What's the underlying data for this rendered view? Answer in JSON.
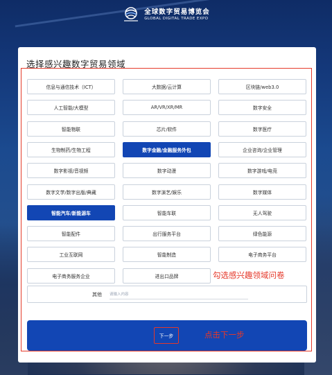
{
  "header": {
    "logo_cn": "全球数字贸易博览会",
    "logo_en": "GLOBAL DIGITAL TRADE EXPO"
  },
  "panel": {
    "title": "选择感兴趣数字贸易领域",
    "options": [
      {
        "label": "信息与通信技术（ICT）",
        "selected": false
      },
      {
        "label": "大数据/云计算",
        "selected": false
      },
      {
        "label": "区块链/web3.0",
        "selected": false
      },
      {
        "label": "人工智能/大模型",
        "selected": false
      },
      {
        "label": "AR/VR/XR/MR",
        "selected": false
      },
      {
        "label": "数字安全",
        "selected": false
      },
      {
        "label": "智能物联",
        "selected": false
      },
      {
        "label": "芯片/软件",
        "selected": false
      },
      {
        "label": "数字医疗",
        "selected": false
      },
      {
        "label": "生物制药/生物工程",
        "selected": false
      },
      {
        "label": "数字金融/金融服务外包",
        "selected": true
      },
      {
        "label": "企业咨询/企业管理",
        "selected": false
      },
      {
        "label": "数字影视/音视频",
        "selected": false
      },
      {
        "label": "数字动漫",
        "selected": false
      },
      {
        "label": "数字游戏/电竞",
        "selected": false
      },
      {
        "label": "数字文学/数字出版/典藏",
        "selected": false
      },
      {
        "label": "数字演艺/娱乐",
        "selected": false
      },
      {
        "label": "数字媒体",
        "selected": false
      },
      {
        "label": "智能汽车/新能源车",
        "selected": true
      },
      {
        "label": "智能车联",
        "selected": false
      },
      {
        "label": "无人驾驶",
        "selected": false
      },
      {
        "label": "智能配件",
        "selected": false
      },
      {
        "label": "出行服务平台",
        "selected": false
      },
      {
        "label": "绿色能源",
        "selected": false
      },
      {
        "label": "工业互联网",
        "selected": false
      },
      {
        "label": "智能制造",
        "selected": false
      },
      {
        "label": "电子商务平台",
        "selected": false
      },
      {
        "label": "电子商务服务企业",
        "selected": false
      },
      {
        "label": "进出口品牌",
        "selected": false
      }
    ],
    "other_label": "其他",
    "other_placeholder": "请输入内容",
    "annotation_select": "勾选感兴趣领域问卷",
    "next_label": "下一步",
    "annotation_next": "点击下一步"
  },
  "colors": {
    "accent": "#1246b4",
    "annotation_red": "#e5382a"
  }
}
